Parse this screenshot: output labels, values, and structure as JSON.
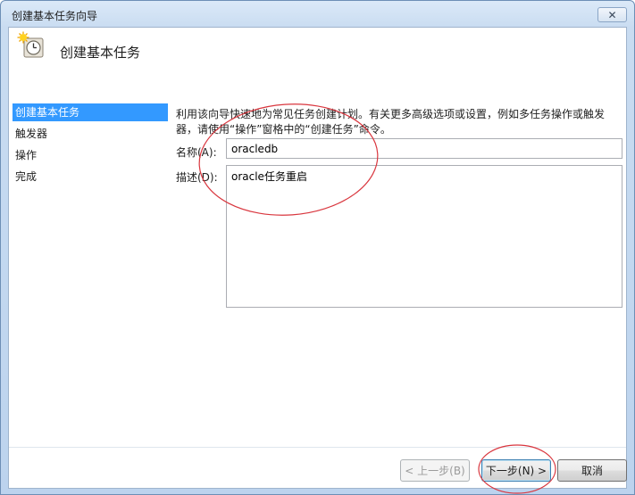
{
  "window": {
    "title": "创建基本任务向导",
    "close_glyph": "✕"
  },
  "header": {
    "title": "创建基本任务"
  },
  "sidebar": {
    "items": [
      {
        "label": "创建基本任务",
        "active": true
      },
      {
        "label": "触发器",
        "active": false
      },
      {
        "label": "操作",
        "active": false
      },
      {
        "label": "完成",
        "active": false
      }
    ]
  },
  "main": {
    "description": "利用该向导快速地为常见任务创建计划。有关更多高级选项或设置，例如多任务操作或触发器，请使用“操作”窗格中的“创建任务”命令。",
    "name_label": "名称(A):",
    "name_value": "oracledb",
    "desc_label": "描述(D):",
    "desc_value": "oracle任务重启"
  },
  "buttons": {
    "back": "< 上一步(B)",
    "next": "下一步(N) >",
    "cancel": "取消"
  },
  "colors": {
    "selection": "#3399ff",
    "annotation": "#d9363e"
  },
  "icons": {
    "header": "scheduled-task-clock-icon",
    "close": "close-icon"
  }
}
